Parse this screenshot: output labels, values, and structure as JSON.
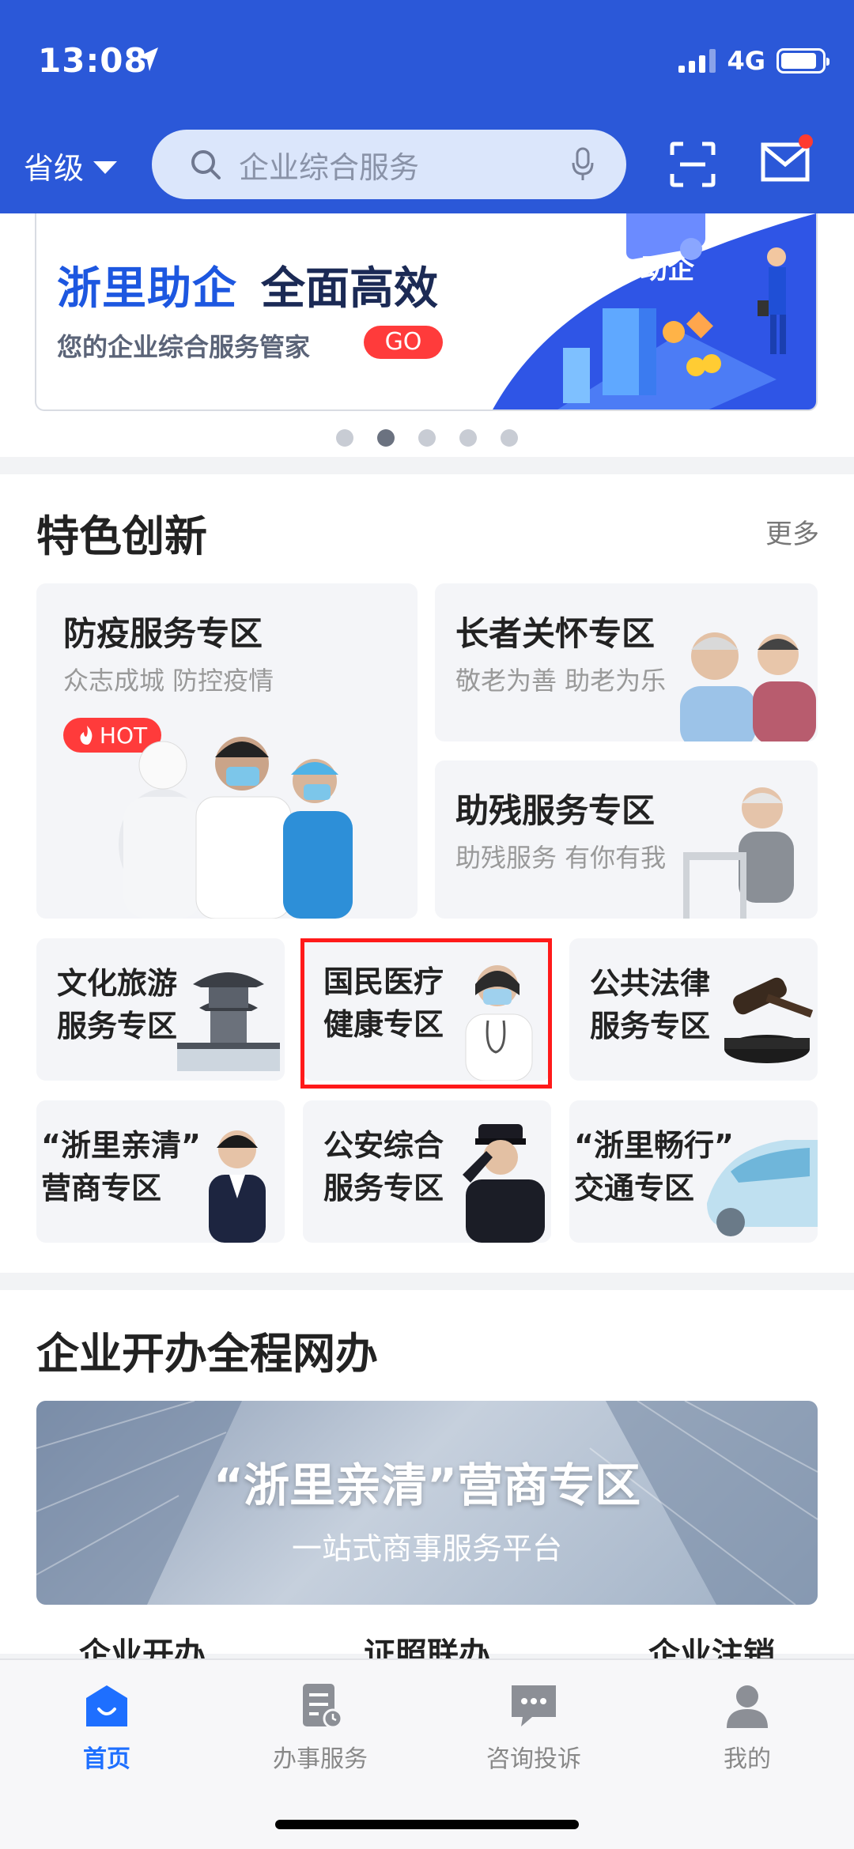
{
  "status_bar": {
    "time": "13:08",
    "network": "4G"
  },
  "header": {
    "region": "省级",
    "search_placeholder": "企业综合服务"
  },
  "banner": {
    "title_blue": "浙里助企",
    "title_dark": "全面高效",
    "subtitle": "您的企业综合服务管家",
    "go_label": "GO",
    "art_text": "助企",
    "page_count": 5,
    "active_index": 1
  },
  "featured": {
    "title": "特色创新",
    "more_label": "更多",
    "big_card": {
      "title": "防疫服务专区",
      "subtitle": "众志成城 防控疫情",
      "badge": "HOT"
    },
    "elder_card": {
      "title": "长者关怀专区",
      "subtitle": "敬老为善 助老为乐"
    },
    "disabled_card": {
      "title": "助残服务专区",
      "subtitle": "助残服务 有你有我"
    },
    "small_cards": [
      {
        "title": "文化旅游服务专区"
      },
      {
        "title": "国民医疗健康专区"
      },
      {
        "title": "公共法律服务专区"
      },
      {
        "title": "“浙里亲清”营商专区"
      },
      {
        "title": "公安综合服务专区"
      },
      {
        "title": "“浙里畅行”交通专区"
      }
    ]
  },
  "startup": {
    "title": "企业开办全程网办",
    "promo_title": "“浙里亲清”营商专区",
    "promo_subtitle": "一站式商事服务平台",
    "tabs": [
      "企业开办",
      "证照联办",
      "企业注销"
    ]
  },
  "bottom_nav": [
    {
      "label": "首页",
      "icon": "home-icon",
      "active": true
    },
    {
      "label": "办事服务",
      "icon": "document-icon",
      "active": false
    },
    {
      "label": "咨询投诉",
      "icon": "chat-icon",
      "active": false
    },
    {
      "label": "我的",
      "icon": "user-icon",
      "active": false
    }
  ],
  "colors": {
    "brand": "#2b58d8",
    "accent_red": "#ff3b3b",
    "nav_active": "#1e6fff"
  }
}
